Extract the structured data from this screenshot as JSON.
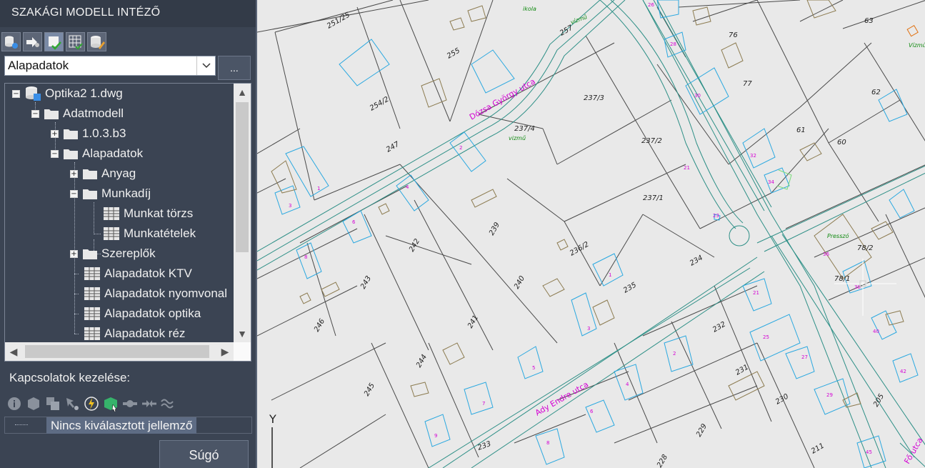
{
  "panel": {
    "title": "SZAKÁGI MODELL INTÉZŐ",
    "toolbar_icons": [
      "database-settings-icon",
      "arrow-connect-icon",
      "model-check-icon",
      "grid-check-icon",
      "database-edit-icon"
    ],
    "combo_value": "Alapadatok",
    "more_label": "...",
    "tree": [
      {
        "label": "Optika2 1.dwg",
        "icon": "database-icon",
        "expander": "−"
      },
      {
        "label": "Adatmodell",
        "icon": "folder-icon",
        "expander": "−"
      },
      {
        "label": "1.0.3.b3",
        "icon": "folder-icon",
        "expander": "+"
      },
      {
        "label": "Alapadatok",
        "icon": "folder-icon",
        "expander": "−"
      },
      {
        "label": "Anyag",
        "icon": "folder-icon",
        "expander": "+"
      },
      {
        "label": "Munkadíj",
        "icon": "folder-icon",
        "expander": "−"
      },
      {
        "label": "Munkat törzs",
        "icon": "table-icon",
        "expander": ""
      },
      {
        "label": "Munkatételek",
        "icon": "table-icon",
        "expander": ""
      },
      {
        "label": "Szereplők",
        "icon": "folder-icon",
        "expander": "+"
      },
      {
        "label": "Alapadatok KTV",
        "icon": "table-icon",
        "expander": ""
      },
      {
        "label": "Alapadatok nyomvonal",
        "icon": "table-icon",
        "expander": ""
      },
      {
        "label": "Alapadatok optika",
        "icon": "table-icon",
        "expander": ""
      },
      {
        "label": "Alapadatok réz",
        "icon": "table-icon",
        "expander": ""
      }
    ],
    "connections_title": "Kapcsolatok kezelése:",
    "connection_icons": [
      "info-icon",
      "cube-icon",
      "cubes-icon",
      "select-link-icon",
      "lightning-icon",
      "green-cube-icon",
      "plug-connect-icon",
      "plug-disconnect-icon",
      "cable-icon"
    ],
    "selection_text": "Nincs kiválasztott jellemző",
    "help_label": "Súgó"
  },
  "map": {
    "parcel_numbers": [
      "251/25",
      "255",
      "257",
      "254/2",
      "247",
      "237/4",
      "237/3",
      "237/2",
      "237/1",
      "76",
      "77",
      "63",
      "62",
      "61",
      "60",
      "242",
      "239",
      "236/2",
      "234",
      "243",
      "240",
      "235",
      "246",
      "241",
      "244",
      "245",
      "232",
      "231",
      "230",
      "233",
      "229",
      "211",
      "228",
      "205",
      "78/2",
      "78/1"
    ],
    "street_names": [
      "Dózsa György utca",
      "Ady Endre utca",
      "Fő utca"
    ],
    "building_notes": [
      "vizmű",
      "Presszó",
      "ikola",
      "Vízmű",
      "vízmű"
    ],
    "axis_label": "Y"
  }
}
